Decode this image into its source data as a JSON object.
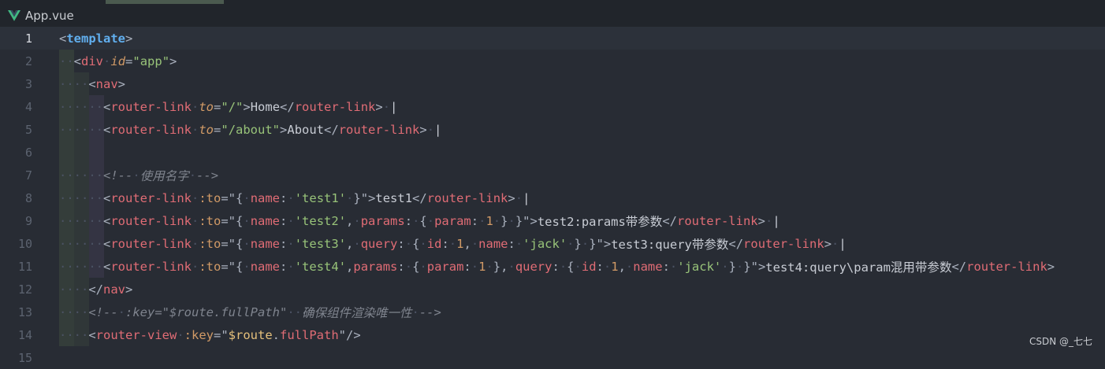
{
  "tab": {
    "filename": "App.vue",
    "icon": "vue-logo-icon"
  },
  "colors": {
    "background": "#282c34",
    "tag": "#e06c75",
    "string": "#98c379",
    "attribute": "#d19a66",
    "comment": "#7f848e",
    "keyword": "#61afef"
  },
  "lines": [
    {
      "num": "1",
      "tokens": [
        [
          "p",
          "<"
        ],
        [
          "tagb",
          "template"
        ],
        [
          "p",
          ">"
        ]
      ]
    },
    {
      "num": "2",
      "tokens": [
        [
          "ws",
          "··"
        ],
        [
          "p",
          "<"
        ],
        [
          "tag",
          "div"
        ],
        [
          "ws",
          "·"
        ],
        [
          "attr",
          "id"
        ],
        [
          "p",
          "="
        ],
        [
          "str",
          "\"app\""
        ],
        [
          "p",
          ">"
        ]
      ]
    },
    {
      "num": "3",
      "tokens": [
        [
          "ws",
          "····"
        ],
        [
          "p",
          "<"
        ],
        [
          "tag",
          "nav"
        ],
        [
          "p",
          ">"
        ]
      ]
    },
    {
      "num": "4",
      "tokens": [
        [
          "ws",
          "······"
        ],
        [
          "p",
          "<"
        ],
        [
          "tag",
          "router-link"
        ],
        [
          "ws",
          "·"
        ],
        [
          "attr",
          "to"
        ],
        [
          "p",
          "="
        ],
        [
          "str",
          "\"/\""
        ],
        [
          "p",
          ">"
        ],
        [
          "txt",
          "Home"
        ],
        [
          "p",
          "</"
        ],
        [
          "tag",
          "router-link"
        ],
        [
          "p",
          ">"
        ],
        [
          "ws",
          "·"
        ],
        [
          "txt",
          "|"
        ]
      ]
    },
    {
      "num": "5",
      "tokens": [
        [
          "ws",
          "······"
        ],
        [
          "p",
          "<"
        ],
        [
          "tag",
          "router-link"
        ],
        [
          "ws",
          "·"
        ],
        [
          "attr",
          "to"
        ],
        [
          "p",
          "="
        ],
        [
          "str",
          "\"/about\""
        ],
        [
          "p",
          ">"
        ],
        [
          "txt",
          "About"
        ],
        [
          "p",
          "</"
        ],
        [
          "tag",
          "router-link"
        ],
        [
          "p",
          ">"
        ],
        [
          "ws",
          "·"
        ],
        [
          "txt",
          "|"
        ]
      ]
    },
    {
      "num": "6",
      "tokens": []
    },
    {
      "num": "7",
      "tokens": [
        [
          "ws",
          "······"
        ],
        [
          "com",
          "<!--"
        ],
        [
          "ws",
          "·"
        ],
        [
          "com",
          "使用名字"
        ],
        [
          "ws",
          "·"
        ],
        [
          "com",
          "-->"
        ]
      ]
    },
    {
      "num": "8",
      "tokens": [
        [
          "ws",
          "······"
        ],
        [
          "p",
          "<"
        ],
        [
          "tag",
          "router-link"
        ],
        [
          "ws",
          "·"
        ],
        [
          "attrn",
          ":to"
        ],
        [
          "p",
          "=\"{"
        ],
        [
          "ws",
          "·"
        ],
        [
          "prop",
          "name"
        ],
        [
          "p",
          ":"
        ],
        [
          "ws",
          "·"
        ],
        [
          "str",
          "'test1'"
        ],
        [
          "ws",
          "·"
        ],
        [
          "p",
          "}\">"
        ],
        [
          "txt",
          "test1"
        ],
        [
          "p",
          "</"
        ],
        [
          "tag",
          "router-link"
        ],
        [
          "p",
          ">"
        ],
        [
          "ws",
          "·"
        ],
        [
          "txt",
          "|"
        ]
      ]
    },
    {
      "num": "9",
      "tokens": [
        [
          "ws",
          "······"
        ],
        [
          "p",
          "<"
        ],
        [
          "tag",
          "router-link"
        ],
        [
          "ws",
          "·"
        ],
        [
          "attrn",
          ":to"
        ],
        [
          "p",
          "=\"{"
        ],
        [
          "ws",
          "·"
        ],
        [
          "prop",
          "name"
        ],
        [
          "p",
          ":"
        ],
        [
          "ws",
          "·"
        ],
        [
          "str",
          "'test2'"
        ],
        [
          "p",
          ","
        ],
        [
          "ws",
          "·"
        ],
        [
          "prop",
          "params"
        ],
        [
          "p",
          ":"
        ],
        [
          "ws",
          "·"
        ],
        [
          "p",
          "{"
        ],
        [
          "ws",
          "·"
        ],
        [
          "prop",
          "param"
        ],
        [
          "p",
          ":"
        ],
        [
          "ws",
          "·"
        ],
        [
          "num",
          "1"
        ],
        [
          "ws",
          "·"
        ],
        [
          "p",
          "}"
        ],
        [
          "ws",
          "·"
        ],
        [
          "p",
          "}\">"
        ],
        [
          "txt",
          "test2:params带参数"
        ],
        [
          "p",
          "</"
        ],
        [
          "tag",
          "router-link"
        ],
        [
          "p",
          ">"
        ],
        [
          "ws",
          "·"
        ],
        [
          "txt",
          "|"
        ]
      ]
    },
    {
      "num": "10",
      "tokens": [
        [
          "ws",
          "······"
        ],
        [
          "p",
          "<"
        ],
        [
          "tag",
          "router-link"
        ],
        [
          "ws",
          "·"
        ],
        [
          "attrn",
          ":to"
        ],
        [
          "p",
          "=\"{"
        ],
        [
          "ws",
          "·"
        ],
        [
          "prop",
          "name"
        ],
        [
          "p",
          ":"
        ],
        [
          "ws",
          "·"
        ],
        [
          "str",
          "'test3'"
        ],
        [
          "p",
          ","
        ],
        [
          "ws",
          "·"
        ],
        [
          "prop",
          "query"
        ],
        [
          "p",
          ":"
        ],
        [
          "ws",
          "·"
        ],
        [
          "p",
          "{"
        ],
        [
          "ws",
          "·"
        ],
        [
          "prop",
          "id"
        ],
        [
          "p",
          ":"
        ],
        [
          "ws",
          "·"
        ],
        [
          "num",
          "1"
        ],
        [
          "p",
          ","
        ],
        [
          "ws",
          "·"
        ],
        [
          "prop",
          "name"
        ],
        [
          "p",
          ":"
        ],
        [
          "ws",
          "·"
        ],
        [
          "str",
          "'jack'"
        ],
        [
          "ws",
          "·"
        ],
        [
          "p",
          "}"
        ],
        [
          "ws",
          "·"
        ],
        [
          "p",
          "}\">"
        ],
        [
          "txt",
          "test3:query带参数"
        ],
        [
          "p",
          "</"
        ],
        [
          "tag",
          "router-link"
        ],
        [
          "p",
          ">"
        ],
        [
          "ws",
          "·"
        ],
        [
          "txt",
          "|"
        ]
      ]
    },
    {
      "num": "11",
      "tokens": [
        [
          "ws",
          "······"
        ],
        [
          "p",
          "<"
        ],
        [
          "tag",
          "router-link"
        ],
        [
          "ws",
          "·"
        ],
        [
          "attrn",
          ":to"
        ],
        [
          "p",
          "=\"{"
        ],
        [
          "ws",
          "·"
        ],
        [
          "prop",
          "name"
        ],
        [
          "p",
          ":"
        ],
        [
          "ws",
          "·"
        ],
        [
          "str",
          "'test4'"
        ],
        [
          "p",
          ","
        ],
        [
          "prop",
          "params"
        ],
        [
          "p",
          ":"
        ],
        [
          "ws",
          "·"
        ],
        [
          "p",
          "{"
        ],
        [
          "ws",
          "·"
        ],
        [
          "prop",
          "param"
        ],
        [
          "p",
          ":"
        ],
        [
          "ws",
          "·"
        ],
        [
          "num",
          "1"
        ],
        [
          "ws",
          "·"
        ],
        [
          "p",
          "},"
        ],
        [
          "ws",
          "·"
        ],
        [
          "prop",
          "query"
        ],
        [
          "p",
          ":"
        ],
        [
          "ws",
          "·"
        ],
        [
          "p",
          "{"
        ],
        [
          "ws",
          "·"
        ],
        [
          "prop",
          "id"
        ],
        [
          "p",
          ":"
        ],
        [
          "ws",
          "·"
        ],
        [
          "num",
          "1"
        ],
        [
          "p",
          ","
        ],
        [
          "ws",
          "·"
        ],
        [
          "prop",
          "name"
        ],
        [
          "p",
          ":"
        ],
        [
          "ws",
          "·"
        ],
        [
          "str",
          "'jack'"
        ],
        [
          "ws",
          "·"
        ],
        [
          "p",
          "}"
        ],
        [
          "ws",
          "·"
        ],
        [
          "p",
          "}\">"
        ],
        [
          "txt",
          "test4:query\\param混用带参数"
        ],
        [
          "p",
          "</"
        ],
        [
          "tag",
          "router-link"
        ],
        [
          "p",
          ">"
        ]
      ]
    },
    {
      "num": "12",
      "tokens": [
        [
          "ws",
          "····"
        ],
        [
          "p",
          "</"
        ],
        [
          "tag",
          "nav"
        ],
        [
          "p",
          ">"
        ]
      ]
    },
    {
      "num": "13",
      "tokens": [
        [
          "ws",
          "····"
        ],
        [
          "com",
          "<!--"
        ],
        [
          "ws",
          "·"
        ],
        [
          "com",
          ":key=\"$route.fullPath\""
        ],
        [
          "ws",
          "··"
        ],
        [
          "com",
          "确保组件渲染唯一性"
        ],
        [
          "ws",
          "·"
        ],
        [
          "com",
          "-->"
        ]
      ]
    },
    {
      "num": "14",
      "tokens": [
        [
          "ws",
          "····"
        ],
        [
          "p",
          "<"
        ],
        [
          "tag",
          "router-view"
        ],
        [
          "ws",
          "·"
        ],
        [
          "attrn",
          ":key"
        ],
        [
          "p",
          "=\""
        ],
        [
          "var",
          "$route"
        ],
        [
          "p",
          "."
        ],
        [
          "prop",
          "fullPath"
        ],
        [
          "p",
          "\"/>"
        ]
      ]
    },
    {
      "num": "15",
      "tokens": []
    }
  ],
  "watermark": "CSDN @_七七"
}
